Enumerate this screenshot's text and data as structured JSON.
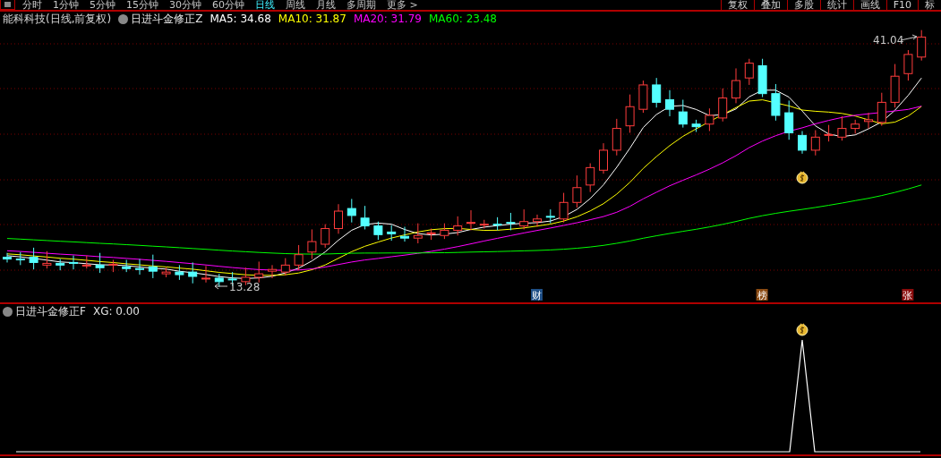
{
  "toolbar": {
    "tabs": [
      {
        "label": "分时",
        "selected": false
      },
      {
        "label": "1分钟",
        "selected": false
      },
      {
        "label": "5分钟",
        "selected": false
      },
      {
        "label": "15分钟",
        "selected": false
      },
      {
        "label": "30分钟",
        "selected": false
      },
      {
        "label": "60分钟",
        "selected": false
      },
      {
        "label": "日线",
        "selected": true
      },
      {
        "label": "周线",
        "selected": false
      },
      {
        "label": "月线",
        "selected": false
      },
      {
        "label": "多周期",
        "selected": false
      },
      {
        "label": "更多 >",
        "selected": false
      }
    ],
    "buttons": [
      "复权",
      "叠加",
      "多股",
      "统计",
      "画线",
      "F10",
      "标"
    ]
  },
  "main_chart": {
    "title": "能科科技(日线,前复权)",
    "indicator": "日进斗金修正Z",
    "ma_readings": [
      {
        "label": "MA5: 34.68",
        "color": "#ffffff"
      },
      {
        "label": "MA10: 31.87",
        "color": "#ffff00"
      },
      {
        "label": "MA20: 31.79",
        "color": "#ff00ff"
      },
      {
        "label": "MA60: 23.48",
        "color": "#00ff00"
      }
    ],
    "annotations": [
      {
        "kind": "high",
        "text": "41.04"
      },
      {
        "kind": "low",
        "text": "13.28"
      }
    ],
    "event_badges": [
      {
        "text": "财",
        "color": "#1f4f86"
      },
      {
        "text": "榜",
        "color": "#8a4a12"
      },
      {
        "text": "张",
        "color": "#8a0c0c"
      }
    ]
  },
  "sub_chart": {
    "indicator": "日进斗金修正F",
    "reading": "XG: 0.00"
  }
}
